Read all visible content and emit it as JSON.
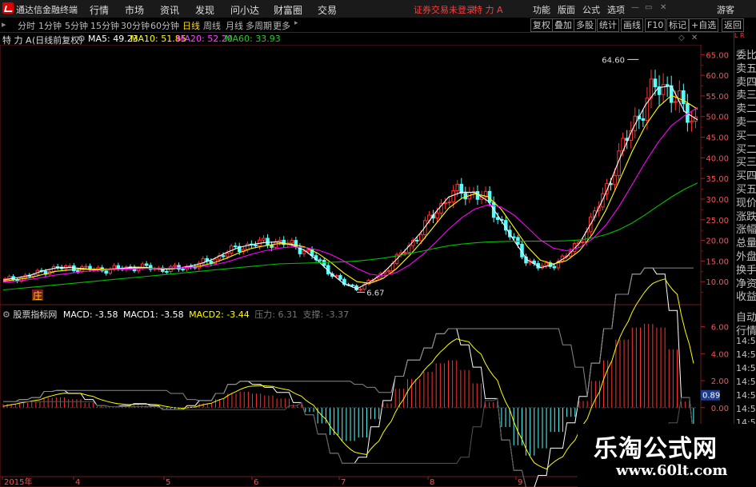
{
  "app": {
    "title": "通达信金融终端",
    "menu": [
      "行情",
      "市场",
      "资讯",
      "发现",
      "问小达",
      "财富圈",
      "交易"
    ],
    "trade_status": "证券交易未登录",
    "stock_name": "特 力 A",
    "right_menu": [
      "功能",
      "版面",
      "公式",
      "选项"
    ],
    "guest": "游客"
  },
  "periods": [
    "分时",
    "1分钟",
    "5分钟",
    "15分钟",
    "30分钟",
    "60分钟",
    "日线",
    "周线",
    "月线",
    "多周期",
    "更多"
  ],
  "active_period": "日线",
  "toolbar_right": [
    "复权",
    "叠加",
    "多股",
    "统计",
    "画线",
    "F10",
    "标记",
    "+自选",
    "返回"
  ],
  "ma_bar": {
    "stock": "特 力 A",
    "adj": "(日线前复权)",
    "ma5": "MA5: 49.23",
    "ma10": "MA10: 51.85",
    "ma20": "MA20: 52.20",
    "ma60": "MA60: 33.93"
  },
  "macd_bar": {
    "title": "股票指标网",
    "macd": "MACD: -3.58",
    "macd1": "MACD1: -3.58",
    "macd2": "MACD2: -3.44",
    "pressure": "压力: 6.31",
    "support": "支撑: -3.37"
  },
  "right_panel": {
    "top": "L R",
    "items": [
      "委比",
      "卖五",
      "卖四",
      "卖三",
      "卖二",
      "卖一",
      "买一",
      "买二",
      "买三",
      "买四",
      "买五",
      "现价",
      "涨跌",
      "涨幅",
      "总量",
      "外盘",
      "换手",
      "净资",
      "收益"
    ],
    "lower_items": [
      "自动",
      "行情",
      "14:50",
      "14:50",
      "14:50",
      "14:50",
      "14:50",
      "14:50",
      "14:50",
      "14:50"
    ]
  },
  "price_axis": [
    "65.00",
    "60.00",
    "55.00",
    "50.00",
    "45.00",
    "40.00",
    "35.00",
    "30.00",
    "25.00",
    "20.00",
    "15.00",
    "10.00"
  ],
  "macd_axis": [
    "6.00",
    "4.00",
    "2.00",
    "0.00"
  ],
  "macd_current": "0.89",
  "date_axis": [
    "2015年",
    "4",
    "5",
    "6",
    "7",
    "8",
    "9"
  ],
  "annotations": {
    "high": "64.60",
    "low": "6.67",
    "marker": "庄"
  },
  "watermark": {
    "line1": "乐淘公式网",
    "line2": "www.60lt.com"
  },
  "colors": {
    "up": "#ff3232",
    "down": "#54ffff",
    "ma5": "#ffffff",
    "ma10": "#ffff00",
    "ma20": "#ff00ff",
    "ma60": "#00c000",
    "border": "#6b1b1b"
  },
  "chart_data": {
    "type": "line",
    "price_range": [
      5,
      67
    ],
    "series": [
      {
        "name": "MA5",
        "values": [
          10.4,
          10.9,
          11.5,
          12.6,
          13.3,
          13.4,
          13.2,
          12.9,
          13.0,
          13.2,
          13.5,
          13.4,
          13.0,
          13.1,
          13.6,
          14.3,
          15.4,
          17.0,
          18.3,
          19.0,
          19.5,
          19.6,
          18.9,
          17.6,
          15.1,
          12.1,
          9.5,
          8.3,
          9.9,
          12.1,
          15.3,
          18.7,
          22.4,
          26.8,
          30.5,
          31.7,
          31.6,
          29.5,
          24.9,
          19.9,
          15.3,
          13.4,
          14.1,
          16.0,
          19.4,
          24.8,
          31.5,
          39.4,
          46.7,
          52.7,
          57.0,
          57.4,
          51.2,
          49.2
        ]
      },
      {
        "name": "MA10",
        "values": [
          10.1,
          10.5,
          10.9,
          11.7,
          12.5,
          12.8,
          13.0,
          13.0,
          13.0,
          13.1,
          13.3,
          13.3,
          13.2,
          13.2,
          13.4,
          13.8,
          14.5,
          15.6,
          17.0,
          18.1,
          18.7,
          19.2,
          19.1,
          18.4,
          16.9,
          14.7,
          12.1,
          10.0,
          9.6,
          10.8,
          13.1,
          16.3,
          19.9,
          23.9,
          27.8,
          30.2,
          31.3,
          30.6,
          27.6,
          23.1,
          18.5,
          15.2,
          14.3,
          15.1,
          17.5,
          21.6,
          27.3,
          34.3,
          41.5,
          47.7,
          52.3,
          55.1,
          53.8,
          51.8
        ]
      },
      {
        "name": "MA20",
        "values": [
          9.8,
          10.1,
          10.5,
          11.0,
          11.6,
          12.0,
          12.4,
          12.7,
          12.9,
          13.0,
          13.1,
          13.2,
          13.2,
          13.3,
          13.4,
          13.6,
          14.0,
          14.7,
          15.7,
          16.7,
          17.5,
          18.1,
          18.4,
          18.3,
          17.7,
          16.6,
          15.0,
          13.2,
          11.8,
          11.4,
          12.2,
          14.0,
          16.5,
          19.5,
          22.7,
          25.5,
          27.6,
          28.6,
          28.1,
          26.1,
          23.2,
          20.1,
          18.1,
          17.5,
          18.3,
          20.4,
          23.7,
          28.2,
          33.5,
          38.9,
          43.8,
          47.8,
          50.2,
          52.2
        ]
      },
      {
        "name": "MA60",
        "values": [
          8.0,
          8.3,
          8.6,
          8.9,
          9.2,
          9.5,
          9.8,
          10.1,
          10.4,
          10.7,
          11.0,
          11.3,
          11.6,
          11.9,
          12.2,
          12.5,
          12.8,
          13.1,
          13.4,
          13.7,
          14.0,
          14.3,
          14.4,
          14.5,
          14.6,
          14.7,
          14.8,
          15.0,
          15.3,
          15.7,
          16.2,
          16.8,
          17.4,
          18.1,
          18.7,
          19.1,
          19.4,
          19.6,
          19.7,
          19.8,
          19.8,
          19.8,
          19.8,
          19.9,
          20.1,
          20.6,
          21.4,
          22.6,
          24.2,
          26.2,
          28.4,
          30.5,
          32.4,
          33.9
        ]
      }
    ],
    "macd_range": [
      -1.2,
      6.8
    ]
  }
}
